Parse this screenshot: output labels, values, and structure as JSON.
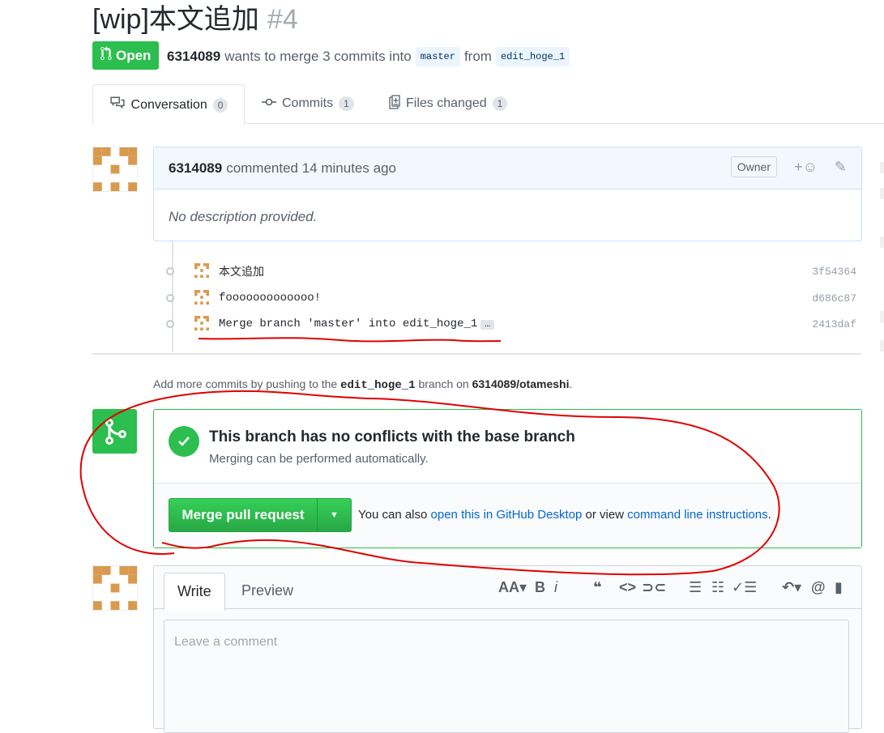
{
  "pr": {
    "title": "[wip]本文追加",
    "number": "#4",
    "state": "Open",
    "author": "6314089",
    "merge_text": "wants to merge 3 commits into",
    "base_branch": "master",
    "from_text": "from",
    "head_branch": "edit_hoge_1"
  },
  "tabs": [
    {
      "label": "Conversation",
      "count": "0"
    },
    {
      "label": "Commits",
      "count": "1"
    },
    {
      "label": "Files changed",
      "count": "1"
    }
  ],
  "comment": {
    "author": "6314089",
    "action": "commented 14 minutes ago",
    "owner_badge": "Owner",
    "body": "No description provided."
  },
  "commits": [
    {
      "message": "本文追加",
      "sha": "3f54364"
    },
    {
      "message": "fooooooooooooo!",
      "sha": "d686c87"
    },
    {
      "message": "Merge branch 'master' into edit_hoge_1",
      "sha": "2413daf"
    }
  ],
  "commit_ellipsis": "…",
  "hint": {
    "prefix": "Add more commits by pushing to the",
    "branch": "edit_hoge_1",
    "middle": "branch on",
    "repo": "6314089/otameshi",
    "suffix": "."
  },
  "merge": {
    "title": "This branch has no conflicts with the base branch",
    "subtitle": "Merging can be performed automatically.",
    "button_label": "Merge pull request",
    "also_prefix": "You can also",
    "desktop_link": "open this in GitHub Desktop",
    "or_view": "or view",
    "cli_link": "command line instructions",
    "period": "."
  },
  "editor": {
    "write_tab": "Write",
    "preview_tab": "Preview",
    "placeholder": "Leave a comment",
    "toolbar": [
      "header-icon",
      "bold-icon",
      "italic-icon",
      "quote-icon",
      "code-icon",
      "link-icon",
      "unordered-list-icon",
      "ordered-list-icon",
      "task-list-icon",
      "reply-icon",
      "mention-icon",
      "bookmark-icon"
    ]
  },
  "colors": {
    "green": "#2cbe4e",
    "link": "#0366d6",
    "annotation": "#e00000"
  }
}
